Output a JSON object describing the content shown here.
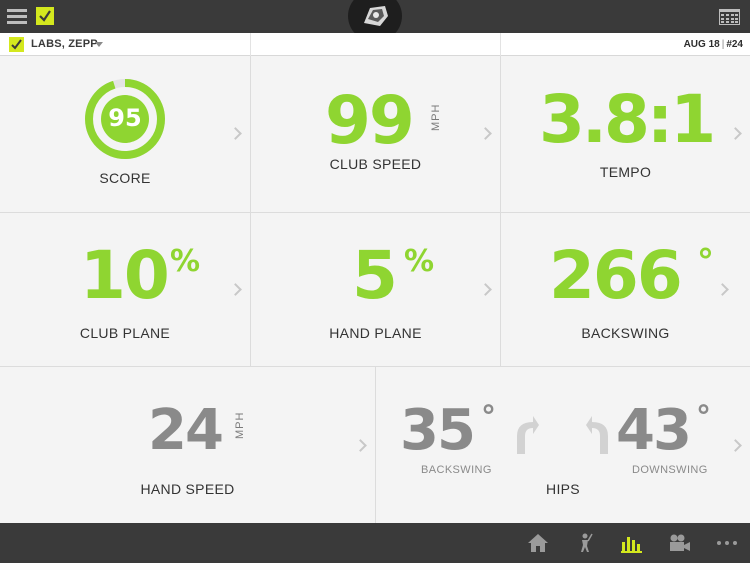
{
  "header": {
    "user_name": "LABS, ZEPP",
    "date": "AUG 18",
    "swing_number": "#24"
  },
  "metrics": {
    "score": {
      "value": "95",
      "label": "SCORE",
      "fraction": 0.95
    },
    "club_speed": {
      "value": "99",
      "unit": "MPH",
      "label": "CLUB SPEED"
    },
    "tempo": {
      "value": "3.8:1",
      "label": "TEMPO"
    },
    "club_plane": {
      "value": "10",
      "unit": "%",
      "label": "CLUB PLANE"
    },
    "hand_plane": {
      "value": "5",
      "unit": "%",
      "label": "HAND PLANE"
    },
    "backswing": {
      "value": "266",
      "unit": "°",
      "label": "BACKSWING"
    },
    "hand_speed": {
      "value": "24",
      "unit": "MPH",
      "label": "HAND SPEED"
    },
    "hips": {
      "label": "HIPS",
      "backswing_value": "35",
      "backswing_unit": "°",
      "backswing_label": "BACKSWING",
      "downswing_value": "43",
      "downswing_unit": "°",
      "downswing_label": "DOWNSWING"
    }
  },
  "colors": {
    "accent_green": "#8fd531",
    "brand_yellow": "#d4e81e",
    "bar_dark": "#3a3a3a",
    "active_nav": "#d4e81e"
  },
  "bottom_nav": {
    "items": [
      "home-icon",
      "golfer-icon",
      "stats-icon",
      "video-icon",
      "more-icon"
    ],
    "active": "stats-icon"
  }
}
